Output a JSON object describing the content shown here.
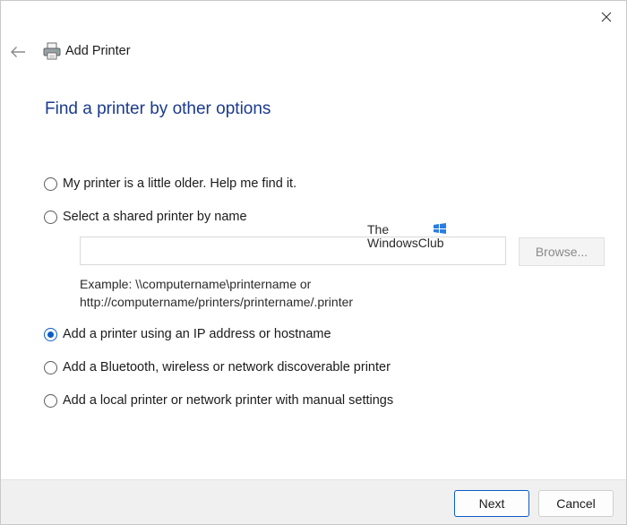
{
  "window": {
    "title": "Add Printer"
  },
  "heading": "Find a printer by other options",
  "options": [
    {
      "label": "My printer is a little older. Help me find it.",
      "checked": false
    },
    {
      "label": "Select a shared printer by name",
      "checked": false
    },
    {
      "label": "Add a printer using an IP address or hostname",
      "checked": true
    },
    {
      "label": "Add a Bluetooth, wireless or network discoverable printer",
      "checked": false
    },
    {
      "label": "Add a local printer or network printer with manual settings",
      "checked": false
    }
  ],
  "shared": {
    "value": "",
    "browse_label": "Browse...",
    "example_line1": "Example: \\\\computername\\printername or",
    "example_line2": "http://computername/printers/printername/.printer"
  },
  "watermark": {
    "line1": "The",
    "line2": "WindowsClub"
  },
  "footer": {
    "next_label": "Next",
    "cancel_label": "Cancel"
  },
  "colors": {
    "heading": "#1a3a8f",
    "accent": "#0b5cc5"
  },
  "icons": {
    "close": "close-icon",
    "back": "back-arrow-icon",
    "printer": "printer-icon"
  }
}
